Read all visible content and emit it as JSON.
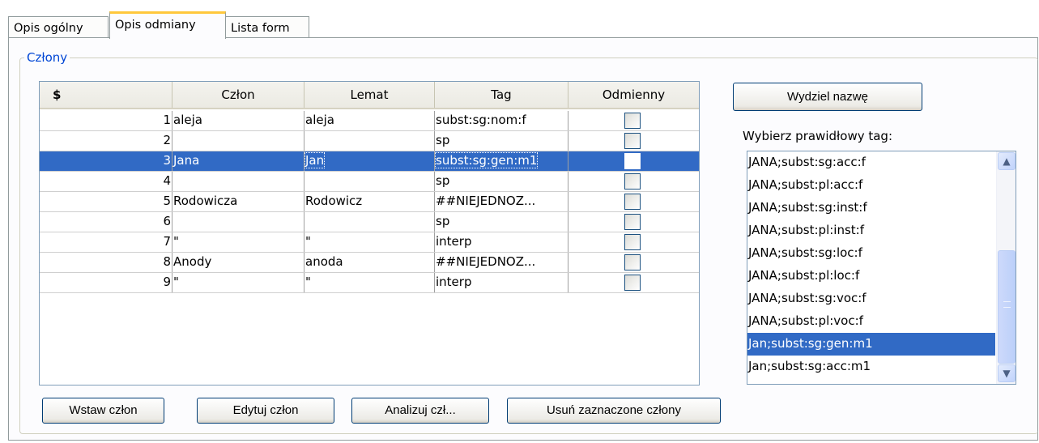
{
  "tabs": [
    {
      "label": "Opis ogólny",
      "active": false
    },
    {
      "label": "Opis odmiany",
      "active": true
    },
    {
      "label": "Lista form",
      "active": false
    }
  ],
  "group_title": "Człony",
  "table": {
    "headers": [
      "$",
      "Człon",
      "Lemat",
      "Tag",
      "Odmienny"
    ],
    "rows": [
      {
        "num": "1",
        "czlon": "aleja",
        "lemat": "aleja",
        "tag": "subst:sg:nom:f",
        "odmienny": false
      },
      {
        "num": "2",
        "czlon": "",
        "lemat": "",
        "tag": "sp",
        "odmienny": false
      },
      {
        "num": "3",
        "czlon": "Jana",
        "lemat": "Jan",
        "tag": "subst:sg:gen:m1",
        "odmienny": false,
        "selected": true
      },
      {
        "num": "4",
        "czlon": "",
        "lemat": "",
        "tag": "sp",
        "odmienny": false
      },
      {
        "num": "5",
        "czlon": "Rodowicza",
        "lemat": "Rodowicz",
        "tag": "##NIEJEDNOZ...",
        "odmienny": false
      },
      {
        "num": "6",
        "czlon": "",
        "lemat": "",
        "tag": "sp",
        "odmienny": false
      },
      {
        "num": "7",
        "czlon": "\"",
        "lemat": "\"",
        "tag": "interp",
        "odmienny": false
      },
      {
        "num": "8",
        "czlon": "Anody",
        "lemat": "anoda",
        "tag": "##NIEJEDNOZ...",
        "odmienny": false
      },
      {
        "num": "9",
        "czlon": "\"",
        "lemat": "\"",
        "tag": "interp",
        "odmienny": false
      }
    ]
  },
  "buttons": {
    "insert": "Wstaw człon",
    "edit": "Edytuj człon",
    "analyze": "Analizuj czł...",
    "delete": "Usuń zaznaczone człony",
    "extract_name": "Wydziel nazwę"
  },
  "choose_tag_label": "Wybierz prawidłowy tag:",
  "tag_list": [
    {
      "label": "JANA;subst:sg:acc:f"
    },
    {
      "label": "JANA;subst:pl:acc:f"
    },
    {
      "label": "JANA;subst:sg:inst:f"
    },
    {
      "label": "JANA;subst:pl:inst:f"
    },
    {
      "label": "JANA;subst:sg:loc:f"
    },
    {
      "label": "JANA;subst:pl:loc:f"
    },
    {
      "label": "JANA;subst:sg:voc:f"
    },
    {
      "label": "JANA;subst:pl:voc:f"
    },
    {
      "label": "Jan;subst:sg:gen:m1",
      "selected": true
    },
    {
      "label": "Jan;subst:sg:acc:m1"
    }
  ],
  "icons": {
    "scroll_up": "▲",
    "scroll_down": "▼"
  }
}
